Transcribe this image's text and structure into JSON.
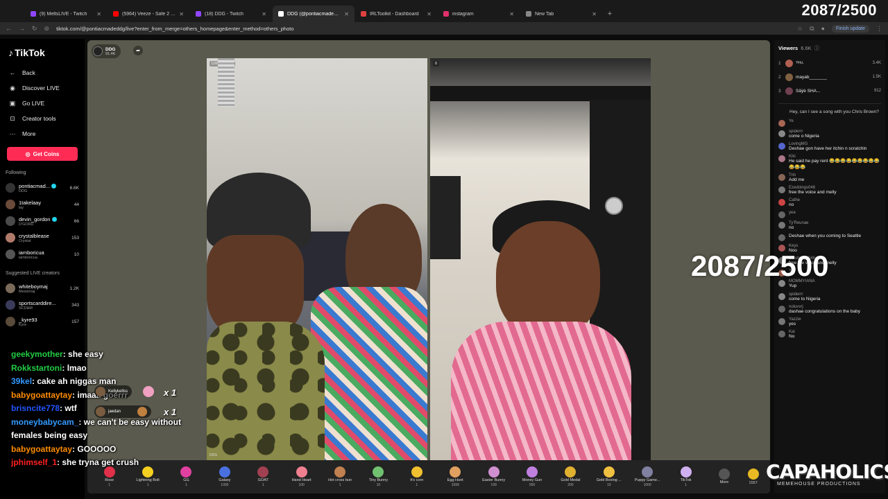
{
  "browser": {
    "tabs": [
      {
        "label": "(9) MeltsLIVE - Twitch",
        "color": "#9146ff",
        "active": false
      },
      {
        "label": "(5964) Veeze - Safe 2 (Offici",
        "color": "#ff0000",
        "active": false
      },
      {
        "label": "(18) DDG - Twitch",
        "color": "#9146ff",
        "active": false
      },
      {
        "label": "DDG (@pontiacmadeddg)",
        "color": "#ffffff",
        "active": true
      },
      {
        "label": "IRLToolkit - Dashboard",
        "color": "#e04040",
        "active": false
      },
      {
        "label": "instagram",
        "color": "#e1306c",
        "active": false
      },
      {
        "label": "New Tab",
        "color": "#888888",
        "active": false
      }
    ],
    "url": "tiktok.com/@pontiacmadeddg/live?enter_from_merge=others_homepage&enter_method=others_photo",
    "finish_update": "Finish update"
  },
  "counter": "2087/2500",
  "sidebar": {
    "logo": "TikTok",
    "back": "Back",
    "nav": [
      {
        "label": "Discover LIVE",
        "icon": "live-icon"
      },
      {
        "label": "Go LIVE",
        "icon": "camera-icon"
      },
      {
        "label": "Creator tools",
        "icon": "tools-icon"
      },
      {
        "label": "More",
        "icon": "more-icon"
      }
    ],
    "get_coins": "Get Coins",
    "following_title": "Following",
    "following": [
      {
        "name": "pontiacmad...",
        "sub": "DDG",
        "count": "6.6K",
        "verified": true,
        "color": "#333"
      },
      {
        "name": "1takelaay",
        "sub": "lay",
        "count": "44",
        "verified": false,
        "color": "#6a4a3a"
      },
      {
        "name": "devin_gordon",
        "sub": "D'GORD",
        "count": "66",
        "verified": true,
        "color": "#4a4a4a"
      },
      {
        "name": "crystalblease",
        "sub": "Crystal",
        "count": "153",
        "verified": false,
        "color": "#b07a6a"
      },
      {
        "name": "iamboricua",
        "sub": "iamboricua",
        "count": "10",
        "verified": false,
        "color": "#555"
      }
    ],
    "suggested_title": "Suggested LIVE creators",
    "suggested": [
      {
        "name": "whiteboymaj",
        "sub": "Messimaj",
        "count": "1.2K",
        "color": "#7a6a5a"
      },
      {
        "name": "sportscarddire...",
        "sub": "SCD&M",
        "count": "343",
        "color": "#3a3a5a"
      },
      {
        "name": "_kyre93",
        "sub": "Kyre",
        "count": "157",
        "color": "#5a4a3a"
      }
    ]
  },
  "stage": {
    "host_name": "DDG",
    "host_likes": "91.4K",
    "left_tag": "LIVE creator",
    "right_tag": "0",
    "left_foot": "DDG"
  },
  "gifts": [
    {
      "name": "Rose",
      "price": "1",
      "color": "#e0304a"
    },
    {
      "name": "Lightning Bolt",
      "price": "1",
      "color": "#f5d020"
    },
    {
      "name": "GG",
      "price": "1",
      "color": "#e040a0"
    },
    {
      "name": "Galaxy",
      "price": "1000",
      "color": "#4a70e0"
    },
    {
      "name": "GOAT",
      "price": "1",
      "color": "#a04050"
    },
    {
      "name": "Hand Heart",
      "price": "100",
      "color": "#f08090"
    },
    {
      "name": "Hot cross bun",
      "price": "1",
      "color": "#c08050"
    },
    {
      "name": "Tiny Bunny",
      "price": "10",
      "color": "#70c070"
    },
    {
      "name": "It's corn",
      "price": "1",
      "color": "#f0c030"
    },
    {
      "name": "Egg Hunt",
      "price": "1999",
      "color": "#e0a060"
    },
    {
      "name": "Easter Bunny",
      "price": "199",
      "color": "#d090d0"
    },
    {
      "name": "Money Gun",
      "price": "500",
      "color": "#c080e0"
    },
    {
      "name": "Gold Medal",
      "price": "200",
      "color": "#e0b030"
    },
    {
      "name": "Gold Boxing ...",
      "price": "10",
      "color": "#f0c040"
    },
    {
      "name": "Puppy Game...",
      "price": "1000",
      "color": "#8080a0"
    },
    {
      "name": "TikTok",
      "price": "1",
      "color": "#d0b0f0"
    },
    {
      "name": "More",
      "price": "",
      "color": "#555555"
    }
  ],
  "coin_balance": "1557",
  "viewers": {
    "title": "Viewers",
    "count": "6.6K",
    "top": [
      {
        "rank": "1",
        "name": "ᵀᴿᴵᴸᴸ",
        "count": "3.4K",
        "color": "#b06050"
      },
      {
        "rank": "2",
        "name": "mayab_______",
        "count": "1.5K",
        "color": "#806040"
      },
      {
        "rank": "3",
        "name": "Sâÿè SHA...",
        "count": "912",
        "color": "#704050"
      }
    ]
  },
  "comments": {
    "top_text": "Hey, can I see a song with you Chris Brown?",
    "items": [
      {
        "user": "Ye",
        "text": "",
        "color": "#aa6655"
      },
      {
        "user": "spiderrr",
        "text": "come o Nigeria",
        "color": "#888"
      },
      {
        "user": "LovingMG",
        "text": "Deshae gon have her itchin n scratchin",
        "color": "#5566cc"
      },
      {
        "user": "Kiki",
        "text": "He said he pay rent 😂😂😂😂😂😂😂😂😂😂😂😂",
        "color": "#aa7788"
      },
      {
        "user": "Trin",
        "text": "Add me",
        "color": "#886655"
      },
      {
        "user": "Ezedoings046",
        "text": "free the voice and melly",
        "color": "#777"
      },
      {
        "user": "Cathe",
        "text": "no",
        "color": "#cc4444"
      },
      {
        "user": "yea",
        "text": "",
        "color": "#666"
      },
      {
        "user": "Ty'Reunae",
        "text": "no",
        "color": "#777"
      },
      {
        "user": "",
        "text": "Deshae when you coming to Seattle",
        "color": "#666"
      },
      {
        "user": "Keys",
        "text": "Noo",
        "color": "#aa5555"
      },
      {
        "user": "Ezedoings046",
        "text": "free the voice and melly",
        "color": "#777"
      },
      {
        "user": "Ye",
        "text": "",
        "color": "#aa6655"
      },
      {
        "user": "MOMMYIANA",
        "text": "Yup",
        "color": "#888"
      },
      {
        "user": "spiderrr",
        "text": "come to Nigeria",
        "color": "#888"
      },
      {
        "user": "noluvvrj",
        "text": "dashae congratulations on the baby",
        "color": "#666"
      },
      {
        "user": "Yazzie",
        "text": "yes",
        "color": "#777"
      },
      {
        "user": "Kai",
        "text": "No",
        "color": "#666"
      }
    ]
  },
  "twitch_chat": [
    {
      "user": "geekymother",
      "text": "she easy",
      "color": "#22cc44"
    },
    {
      "user": "Rokkstartoni",
      "text": "lmao",
      "color": "#22cc44"
    },
    {
      "user": "39kel",
      "text": "cake ah niggas man",
      "color": "#3399ff"
    },
    {
      "user": "babygoattaytay",
      "text": "imaaa goerrr",
      "color": "#ff8c00"
    },
    {
      "user": "brisncite778",
      "text": "wtf",
      "color": "#2255ff"
    },
    {
      "user": "moneybabycam_",
      "text": "we can't be easy without females being easy",
      "color": "#3399ff"
    },
    {
      "user": "babygoattaytay",
      "text": "GOOOOO",
      "color": "#ff8c00"
    },
    {
      "user": "jphimself_1",
      "text": "she tryna get crush",
      "color": "#ff2020"
    }
  ],
  "gift_toasts": [
    {
      "name": "Kellykellss",
      "multiplier": "x 1"
    },
    {
      "name": "jaedan",
      "multiplier": "x 1"
    }
  ],
  "brand": {
    "title": "CAPAHOLICS",
    "subtitle": "MEMEHOUSE PRODUCTIONS"
  }
}
